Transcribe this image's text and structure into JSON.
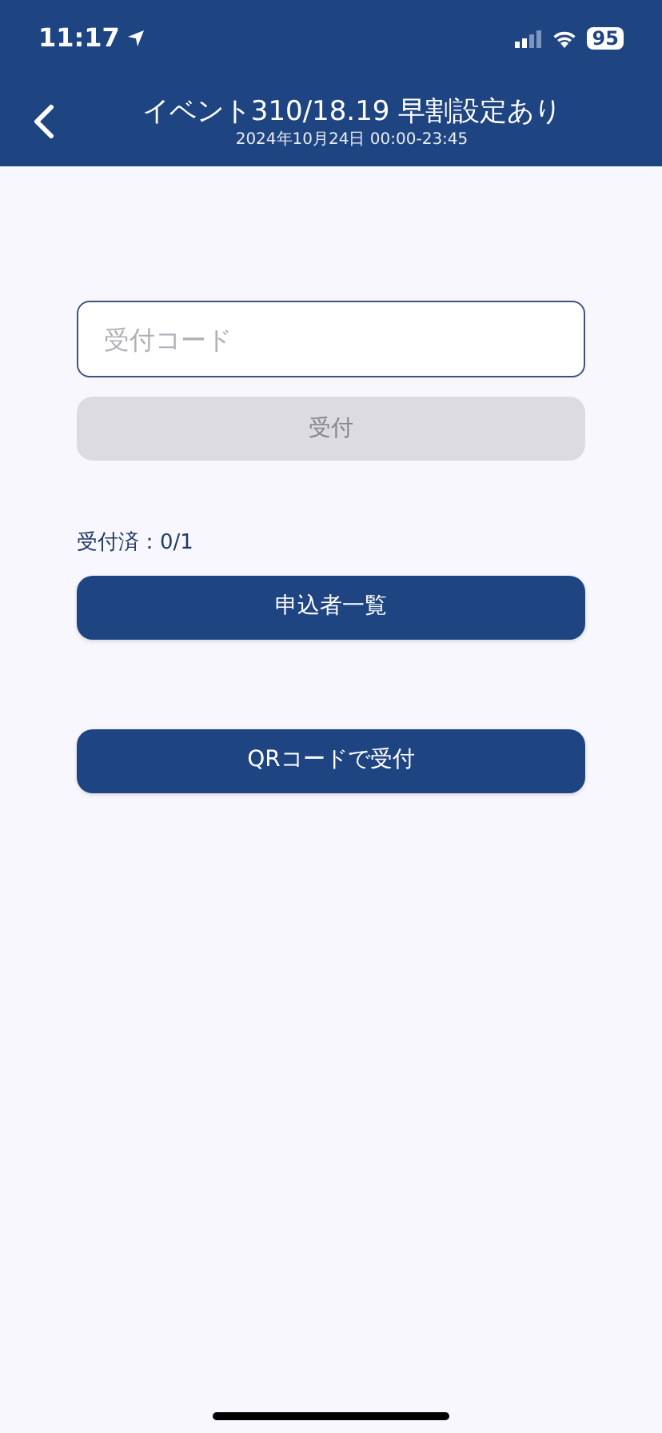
{
  "status_bar": {
    "time": "11:17",
    "battery": "95"
  },
  "header": {
    "title": "イベント310/18.19 早割設定あり",
    "subtitle": "2024年10月24日 00:00-23:45"
  },
  "code_field": {
    "placeholder": "受付コード"
  },
  "submit_button": {
    "label": "受付",
    "disabled": true
  },
  "checked_in": "受付済：0/1",
  "buttons": [
    {
      "label": "申込者一覧"
    },
    {
      "label": "QRコードで受付"
    }
  ]
}
